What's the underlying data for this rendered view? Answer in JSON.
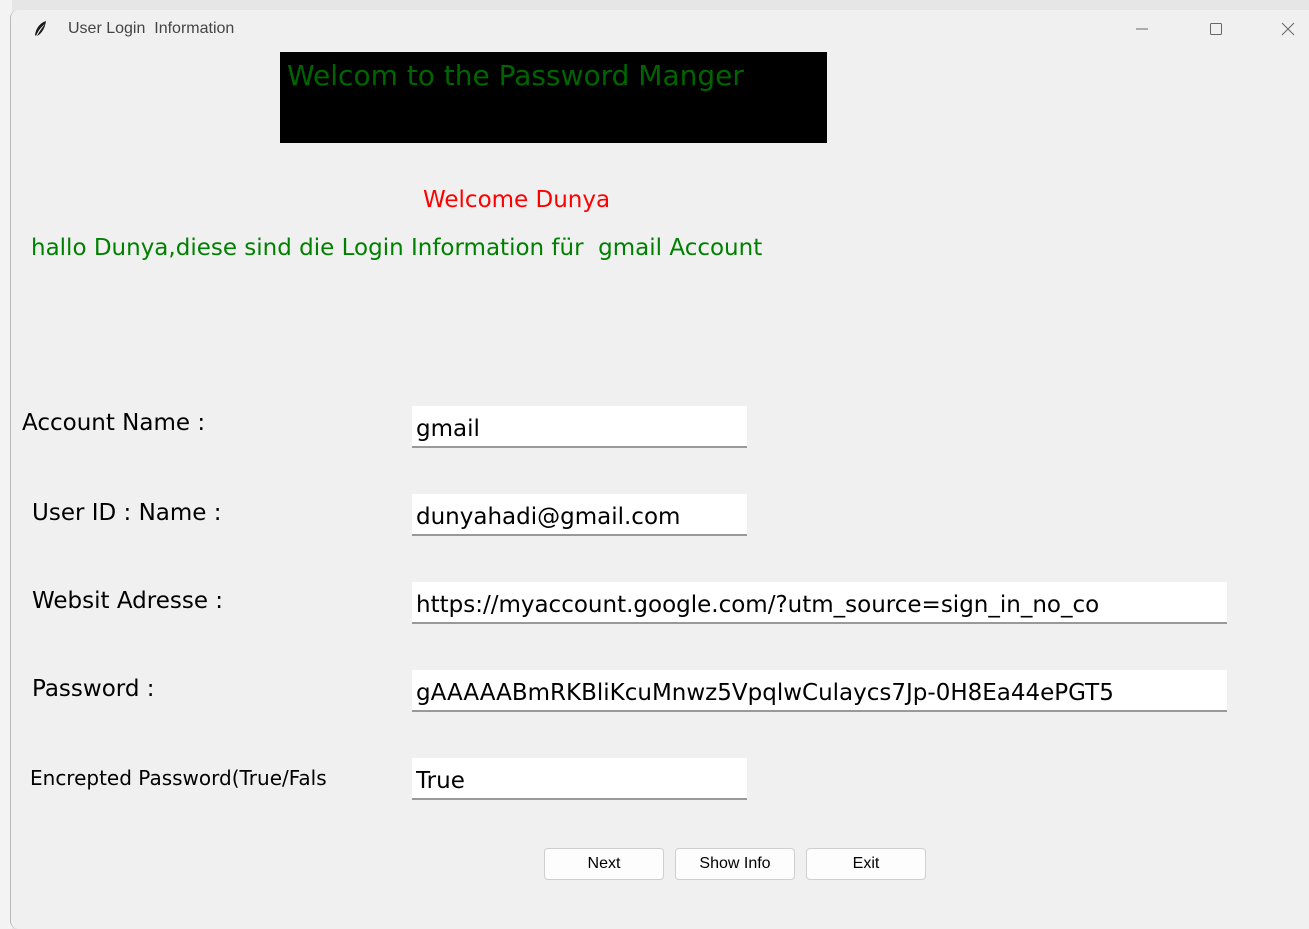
{
  "window": {
    "title": "User Login  Information",
    "icon": "feather-icon",
    "controls": {
      "minimize_icon": "minimize-icon",
      "maximize_icon": "maximize-icon",
      "close_icon": "close-icon"
    }
  },
  "banner": {
    "text": "Welcom to the Password Manger",
    "bg_color": "#000000",
    "text_color": "#006400"
  },
  "welcome": {
    "text": "Welcome Dunya",
    "color": "#ff0000"
  },
  "info_line": {
    "text": "hallo Dunya,diese sind die Login Information für  gmail Account",
    "color": "#008000"
  },
  "fields": {
    "account_name": {
      "label": "Account Name :",
      "value": "gmail"
    },
    "user_id": {
      "label": "User ID : Name :",
      "value": "dunyahadi@gmail.com"
    },
    "website": {
      "label": "Websit Adresse :",
      "value": "https://myaccount.google.com/?utm_source=sign_in_no_co"
    },
    "password": {
      "label": "Password :",
      "value": "gAAAAABmRKBliKcuMnwz5VpqlwCulaycs7Jp-0H8Ea44ePGT5"
    },
    "encrypted": {
      "label": "Encrepted Password(True/Fals",
      "value": "True"
    }
  },
  "buttons": {
    "next": "Next",
    "show_info": "Show Info",
    "exit": "Exit"
  }
}
